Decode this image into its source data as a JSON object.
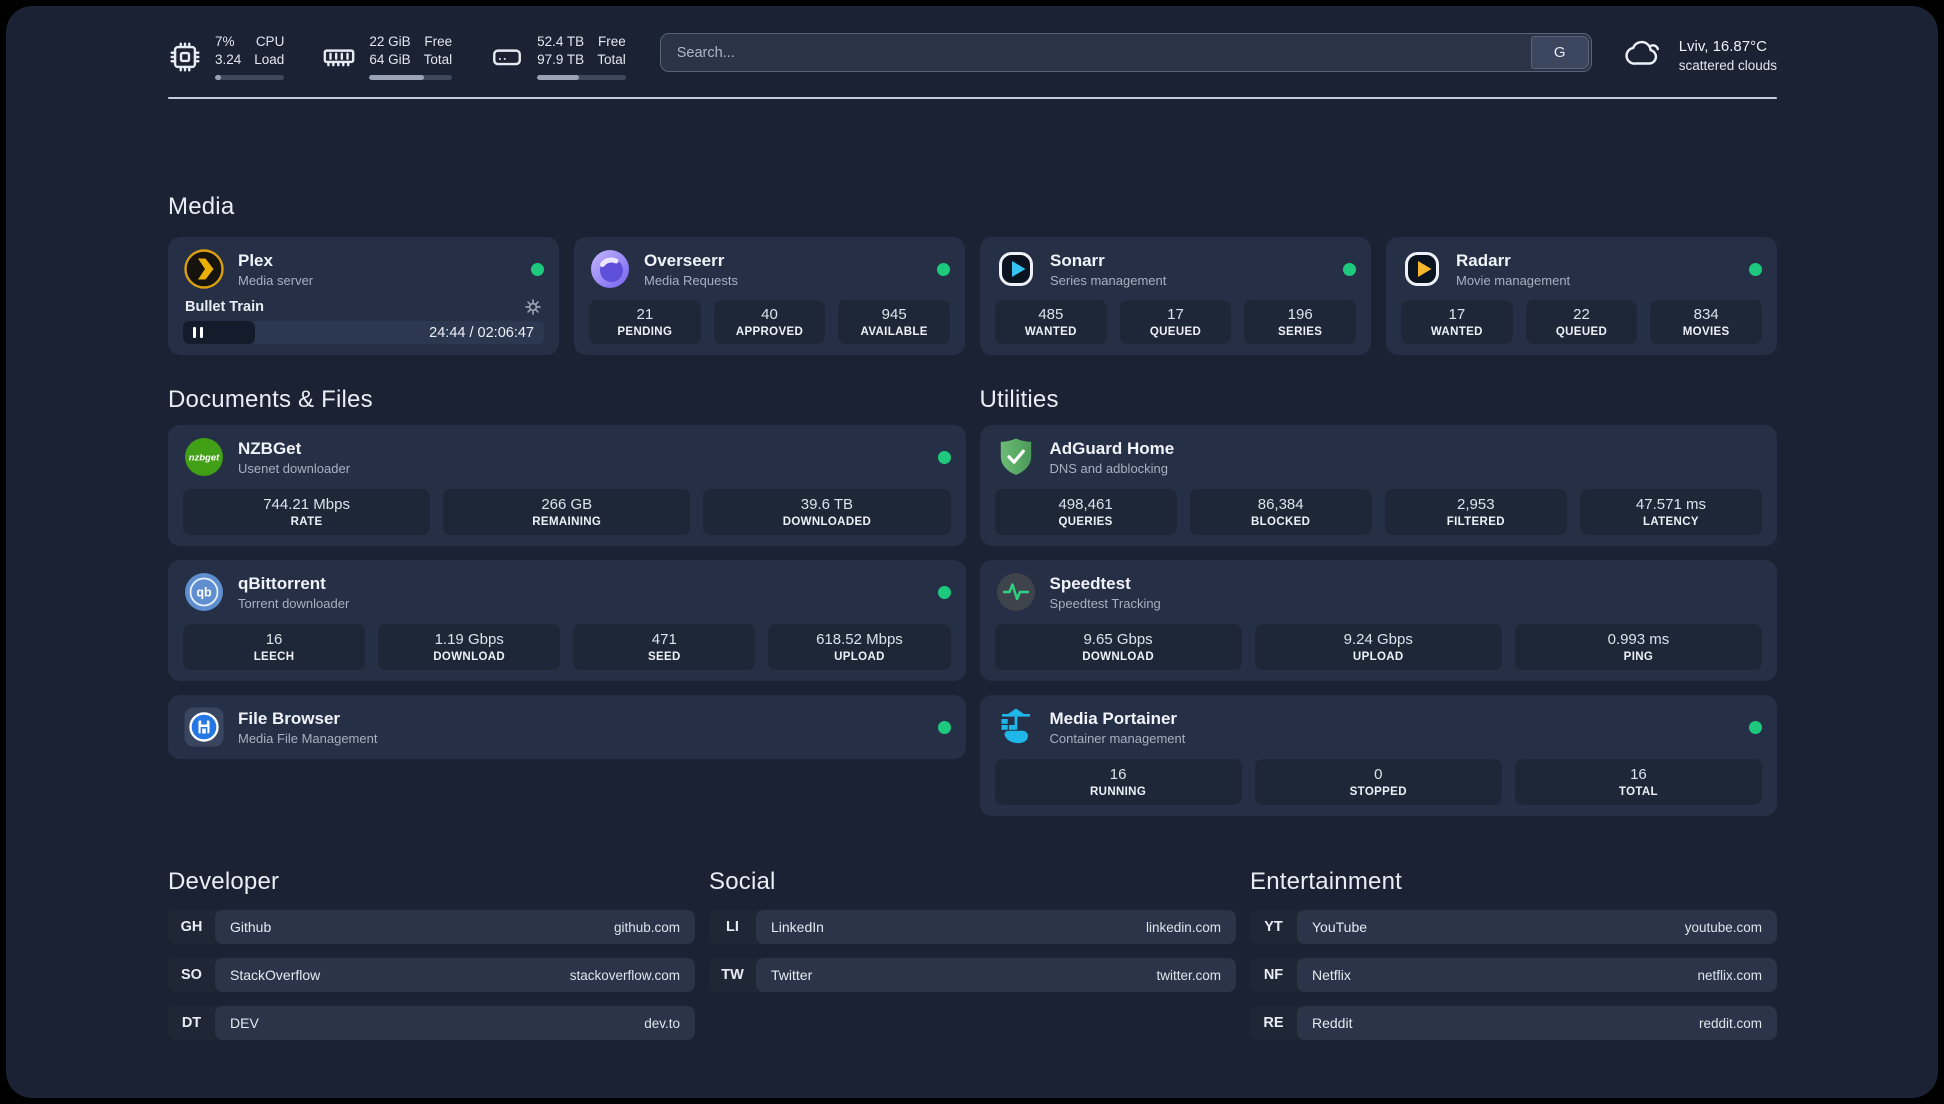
{
  "header": {
    "sys_stats": [
      {
        "icon": "cpu",
        "value_top": "7%",
        "value_bottom": "3.24",
        "label_top": "CPU",
        "label_bottom": "Load",
        "progress_pct": 8
      },
      {
        "icon": "memory",
        "value_top": "22 GiB",
        "value_bottom": "64 GiB",
        "label_top": "Free",
        "label_bottom": "Total",
        "progress_pct": 66
      },
      {
        "icon": "disk",
        "value_top": "52.4 TB",
        "value_bottom": "97.9 TB",
        "label_top": "Free",
        "label_bottom": "Total",
        "progress_pct": 47
      }
    ],
    "search": {
      "placeholder": "Search...",
      "button_label": "G"
    },
    "weather": {
      "summary": "Lviv, 16.87°C",
      "condition": "scattered clouds"
    }
  },
  "media": {
    "section_title": "Media",
    "plex": {
      "title": "Plex",
      "subtitle": "Media server",
      "online": true,
      "now_playing": {
        "track": "Bullet Train",
        "time_display": "24:44 / 02:06:47",
        "progress_pct": 20
      }
    },
    "overseerr": {
      "title": "Overseerr",
      "subtitle": "Media Requests",
      "online": true,
      "stats": [
        {
          "value": "21",
          "label": "PENDING"
        },
        {
          "value": "40",
          "label": "APPROVED"
        },
        {
          "value": "945",
          "label": "AVAILABLE"
        }
      ]
    },
    "sonarr": {
      "title": "Sonarr",
      "subtitle": "Series management",
      "online": true,
      "stats": [
        {
          "value": "485",
          "label": "WANTED"
        },
        {
          "value": "17",
          "label": "QUEUED"
        },
        {
          "value": "196",
          "label": "SERIES"
        }
      ]
    },
    "radarr": {
      "title": "Radarr",
      "subtitle": "Movie management",
      "online": true,
      "stats": [
        {
          "value": "17",
          "label": "WANTED"
        },
        {
          "value": "22",
          "label": "QUEUED"
        },
        {
          "value": "834",
          "label": "MOVIES"
        }
      ]
    }
  },
  "documents": {
    "section_title": "Documents & Files",
    "nzbget": {
      "title": "NZBGet",
      "subtitle": "Usenet downloader",
      "online": true,
      "stats": [
        {
          "value": "744.21 Mbps",
          "label": "RATE"
        },
        {
          "value": "266 GB",
          "label": "REMAINING"
        },
        {
          "value": "39.6 TB",
          "label": "DOWNLOADED"
        }
      ]
    },
    "qbittorrent": {
      "title": "qBittorrent",
      "subtitle": "Torrent downloader",
      "online": true,
      "stats": [
        {
          "value": "16",
          "label": "LEECH"
        },
        {
          "value": "1.19 Gbps",
          "label": "DOWNLOAD"
        },
        {
          "value": "471",
          "label": "SEED"
        },
        {
          "value": "618.52 Mbps",
          "label": "UPLOAD"
        }
      ]
    },
    "filebrowser": {
      "title": "File Browser",
      "subtitle": "Media File Management",
      "online": true
    }
  },
  "utilities": {
    "section_title": "Utilities",
    "adguard": {
      "title": "AdGuard Home",
      "subtitle": "DNS and adblocking",
      "stats": [
        {
          "value": "498,461",
          "label": "QUERIES"
        },
        {
          "value": "86,384",
          "label": "BLOCKED"
        },
        {
          "value": "2,953",
          "label": "FILTERED"
        },
        {
          "value": "47.571 ms",
          "label": "LATENCY"
        }
      ]
    },
    "speedtest": {
      "title": "Speedtest",
      "subtitle": "Speedtest Tracking",
      "stats": [
        {
          "value": "9.65 Gbps",
          "label": "DOWNLOAD"
        },
        {
          "value": "9.24 Gbps",
          "label": "UPLOAD"
        },
        {
          "value": "0.993 ms",
          "label": "PING"
        }
      ]
    },
    "portainer": {
      "title": "Media Portainer",
      "subtitle": "Container management",
      "online": true,
      "stats": [
        {
          "value": "16",
          "label": "RUNNING"
        },
        {
          "value": "0",
          "label": "STOPPED"
        },
        {
          "value": "16",
          "label": "TOTAL"
        }
      ]
    }
  },
  "links": {
    "developer": {
      "section_title": "Developer",
      "items": [
        {
          "abbr": "GH",
          "name": "Github",
          "url": "github.com"
        },
        {
          "abbr": "SO",
          "name": "StackOverflow",
          "url": "stackoverflow.com"
        },
        {
          "abbr": "DT",
          "name": "DEV",
          "url": "dev.to"
        }
      ]
    },
    "social": {
      "section_title": "Social",
      "items": [
        {
          "abbr": "LI",
          "name": "LinkedIn",
          "url": "linkedin.com"
        },
        {
          "abbr": "TW",
          "name": "Twitter",
          "url": "twitter.com"
        }
      ]
    },
    "entertainment": {
      "section_title": "Entertainment",
      "items": [
        {
          "abbr": "YT",
          "name": "YouTube",
          "url": "youtube.com"
        },
        {
          "abbr": "NF",
          "name": "Netflix",
          "url": "netflix.com"
        },
        {
          "abbr": "RE",
          "name": "Reddit",
          "url": "reddit.com"
        }
      ]
    }
  },
  "icons": {
    "nzbget_label": "nzbget",
    "qbittorrent_label": "qb"
  },
  "colors": {
    "online_green": "#1ec97e",
    "plex_amber": "#ebaf00",
    "sonarr_cyan": "#36c3f1",
    "radarr_amber": "#f7b52c",
    "adguard_green": "#5aab66",
    "portainer_blue": "#1fb7ea"
  }
}
